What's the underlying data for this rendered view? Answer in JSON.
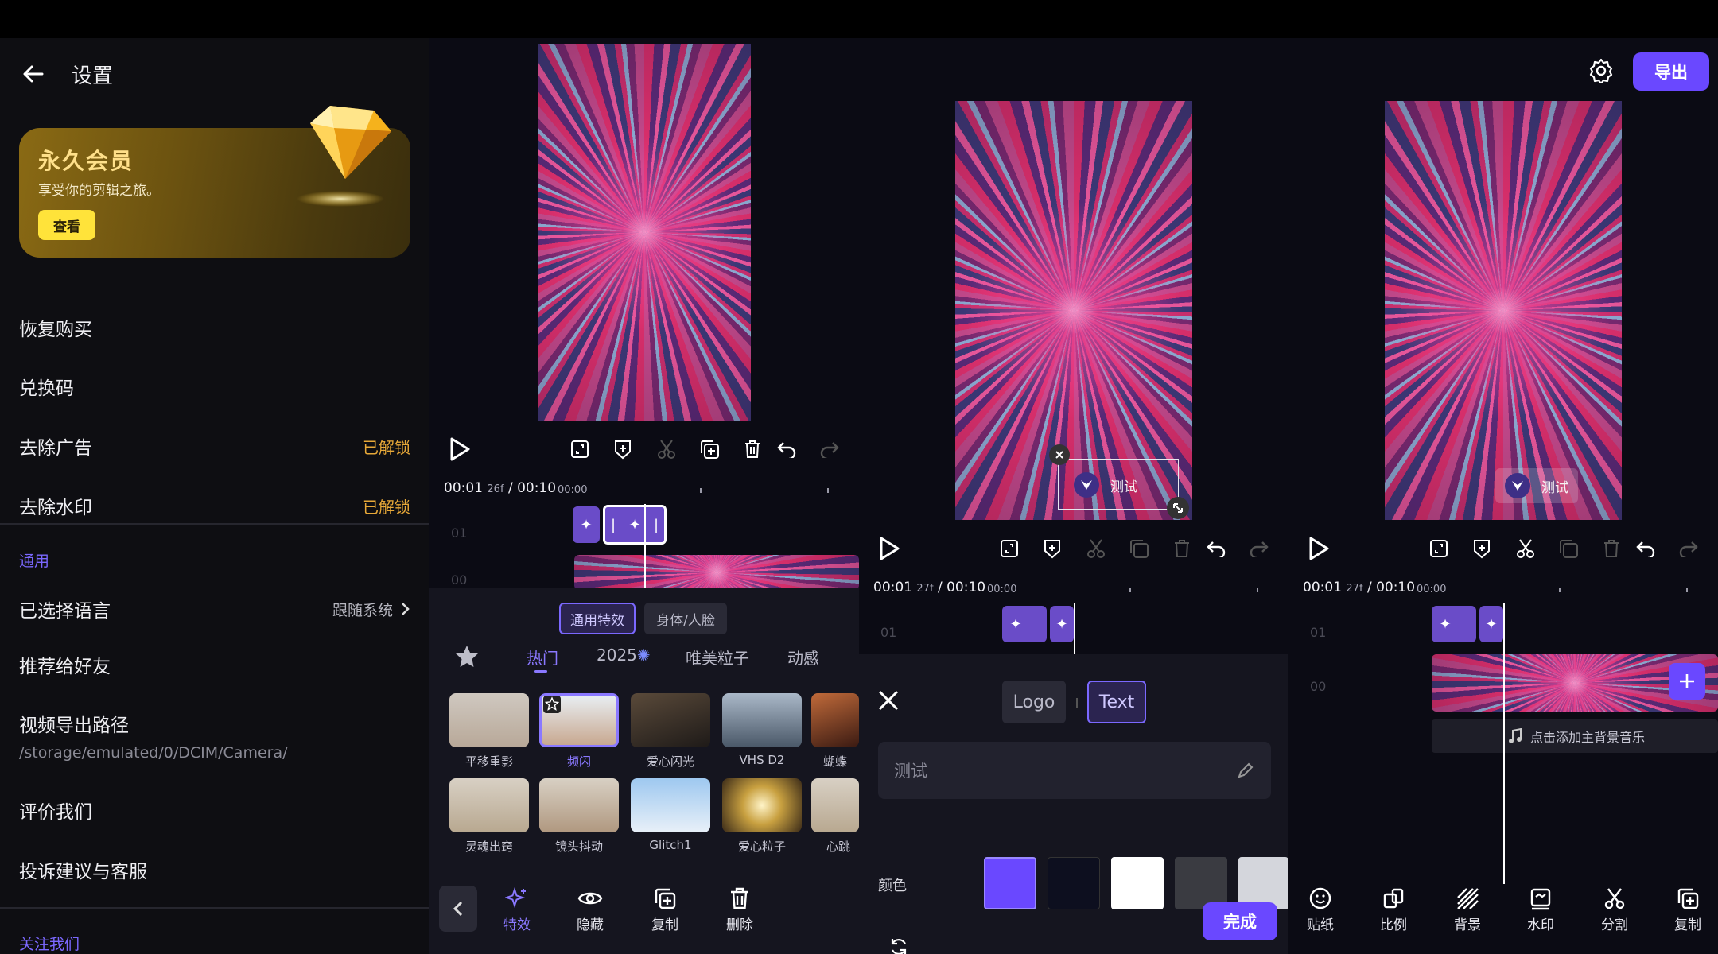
{
  "settings": {
    "title": "设置",
    "vip": {
      "title": "永久会员",
      "subtitle": "享受你的剪辑之旅。",
      "button": "查看"
    },
    "rows": {
      "restore": "恢复购买",
      "redeem": "兑换码",
      "remove_ads": "去除广告",
      "remove_ads_status": "已解锁",
      "remove_wm": "去除水印",
      "remove_wm_status": "已解锁",
      "general": "通用",
      "language": "已选择语言",
      "language_value": "跟随系统",
      "share": "推荐给好友",
      "export_path": "视频导出路径",
      "export_path_value": "/storage/emulated/0/DCIM/Camera/",
      "rate": "评价我们",
      "feedback": "投诉建议与客服",
      "follow": "关注我们"
    }
  },
  "editor_effects": {
    "timecode": "00:01",
    "frames": "26f",
    "total": "/ 00:10",
    "tick_zero": "00:00",
    "track1": "01",
    "track0": "00",
    "pills": [
      "通用特效",
      "身体/人脸"
    ],
    "categories": [
      "热门",
      "2025",
      "唯美粒子",
      "动感"
    ],
    "thumbs_row1": [
      "平移重影",
      "频闪",
      "爱心闪光",
      "VHS D2",
      "蝴蝶"
    ],
    "thumbs_row2": [
      "灵魂出窍",
      "镜头抖动",
      "Glitch1",
      "爱心粒子",
      "心跳"
    ],
    "bottom": [
      "特效",
      "隐藏",
      "复制",
      "删除"
    ]
  },
  "editor_text": {
    "timecode": "00:01",
    "frames": "27f",
    "total": "/ 00:10",
    "tick_zero": "00:00",
    "track1": "01",
    "watermark_text": "测试",
    "tabs": [
      "Logo",
      "Text"
    ],
    "input_placeholder": "测试",
    "color_label": "颜色",
    "colors": [
      "#6a48ff",
      "#0d0f1f",
      "#ffffff",
      "#3a3b41",
      "#d4d6dc"
    ],
    "reset": "重置",
    "done": "完成"
  },
  "editor_main": {
    "export": "导出",
    "timecode": "00:01",
    "frames": "27f",
    "total": "/ 00:10",
    "tick_zero": "00:00",
    "track1": "01",
    "track0": "00",
    "watermark_text": "测试",
    "music_hint": "点击添加主背景音乐",
    "bottom": [
      "贴纸",
      "比例",
      "背景",
      "水印",
      "分割",
      "复制"
    ]
  },
  "colors": {
    "accent": "#6a48ff",
    "unlocked": "#e7a838",
    "gold": "#ffe08a"
  }
}
